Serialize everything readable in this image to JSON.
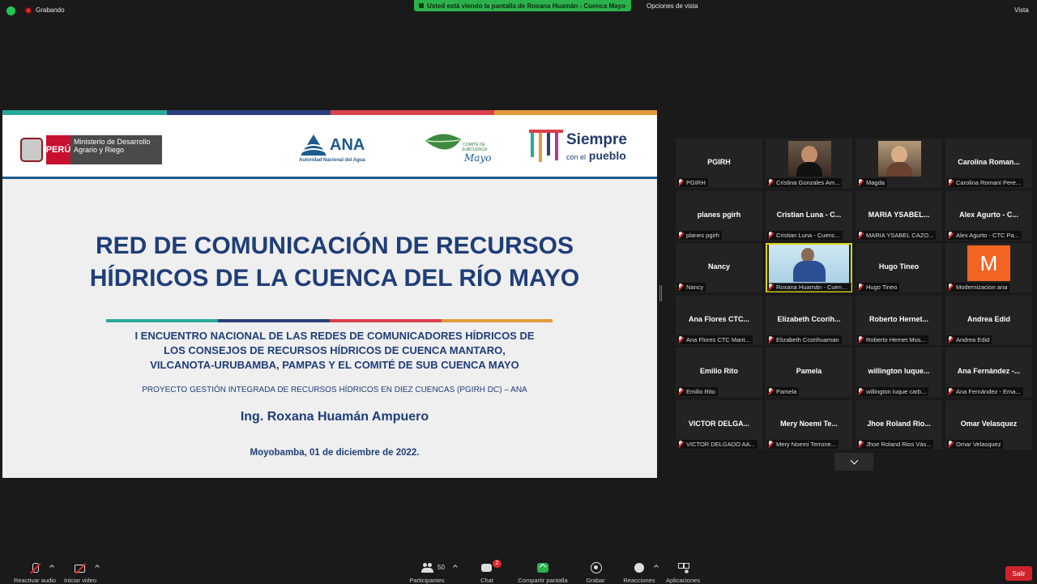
{
  "topbar": {
    "recording_label": "Grabando",
    "share_banner": "Usted está viendo la pantalla de Roxana Huamán - Cuenca Mayo",
    "view_options": "Opciones de vista",
    "view_label": "Vista"
  },
  "slide": {
    "stripe_colors": [
      "#2aa99a",
      "#2c3f7c",
      "#d9404a",
      "#e29a3c"
    ],
    "peru": {
      "country": "PERÚ",
      "ministry": "Ministerio de Desarrollo Agrario y Riego"
    },
    "ana": {
      "word": "ANA",
      "sub": "Autoridad Nacional del Agua"
    },
    "comite": {
      "small": "COMITÉ DE SUBCUENCA",
      "name": "Mayo"
    },
    "siempre": {
      "main": "Siempre",
      "sub_small": "con el",
      "sub": "pueblo"
    },
    "title_line1": "RED DE COMUNICACIÓN DE RECURSOS",
    "title_line2": "HÍDRICOS DE LA CUENCA DEL RÍO MAYO",
    "subtitle_line1": "I ENCUENTRO NACIONAL DE LAS REDES DE COMUNICADORES HÍDRICOS DE",
    "subtitle_line2": "LOS CONSEJOS DE RECURSOS HÍDRICOS DE CUENCA MANTARO,",
    "subtitle_line3": "VILCANOTA-URUBAMBA, PAMPAS Y EL COMITÉ DE SUB CUENCA MAYO",
    "project": "PROYECTO GESTIÓN INTEGRADA DE RECURSOS HÍDRICOS EN DIEZ CUENCAS (PGIRH DC) – ANA",
    "presenter": "Ing. Roxana Huamán Ampuero",
    "place_date": "Moyobamba, 01 de diciembre de 2022."
  },
  "gallery": {
    "tiles": [
      {
        "name": "PGIRH",
        "label": "PGIRH"
      },
      {
        "name": "",
        "label": "Cristina Gonzales Am..."
      },
      {
        "name": "",
        "label": "Magda"
      },
      {
        "name": "Carolina  Roman...",
        "label": "Carolina Romani Pere..."
      },
      {
        "name": "planes pgirh",
        "label": "planes pgirh"
      },
      {
        "name": "Cristian Luna - C...",
        "label": "Cristian Luna - Cuenc..."
      },
      {
        "name": "MARIA YSABEL...",
        "label": "MARIA YSABEL CAZO..."
      },
      {
        "name": "Alex Agurto - C...",
        "label": "Alex Agurto - CTC Pa..."
      },
      {
        "name": "Nancy",
        "label": "Nancy"
      },
      {
        "name": "",
        "label": "Roxana Huamán - Cuenc..."
      },
      {
        "name": "Hugo Tineo",
        "label": "Hugo Tineo"
      },
      {
        "name": "",
        "label": "Modernizacion ana",
        "avatar": "M"
      },
      {
        "name": "Ana Flores  CTC...",
        "label": "Ana Flores CTC Mant..."
      },
      {
        "name": "Elizabeth  Ccorih...",
        "label": "Elizabeth Ccorihuaman"
      },
      {
        "name": "Roberto  Hernet...",
        "label": "Roberto Hernet Mos..."
      },
      {
        "name": "Andrea Edid",
        "label": "Andrea Edid"
      },
      {
        "name": "Emilio Rito",
        "label": "Emilio Rito"
      },
      {
        "name": "Pamela",
        "label": "Pamela"
      },
      {
        "name": "willington  luque...",
        "label": "willington luque carb..."
      },
      {
        "name": "Ana  Fernández  -...",
        "label": "Ana Fernández - Ema..."
      },
      {
        "name": "VICTOR  DELGA...",
        "label": "VICTOR DELGADO AA..."
      },
      {
        "name": "Mery   Noemi  Te...",
        "label": "Mery  Noemi Terrone..."
      },
      {
        "name": "Jhoe Roland  Rio...",
        "label": "Jhoe Roland Rios Vás..."
      },
      {
        "name": "Omar Velasquez",
        "label": "Omar Velasquez"
      }
    ]
  },
  "toolbar": {
    "audio": "Reactivar audio",
    "video": "Iniciar video",
    "participants": "Participantes",
    "participants_count": "50",
    "chat": "Chat",
    "chat_badge": "2",
    "share": "Compartir pantalla",
    "record": "Grabar",
    "reactions": "Reacciones",
    "apps": "Aplicaciones",
    "leave": "Salir"
  }
}
